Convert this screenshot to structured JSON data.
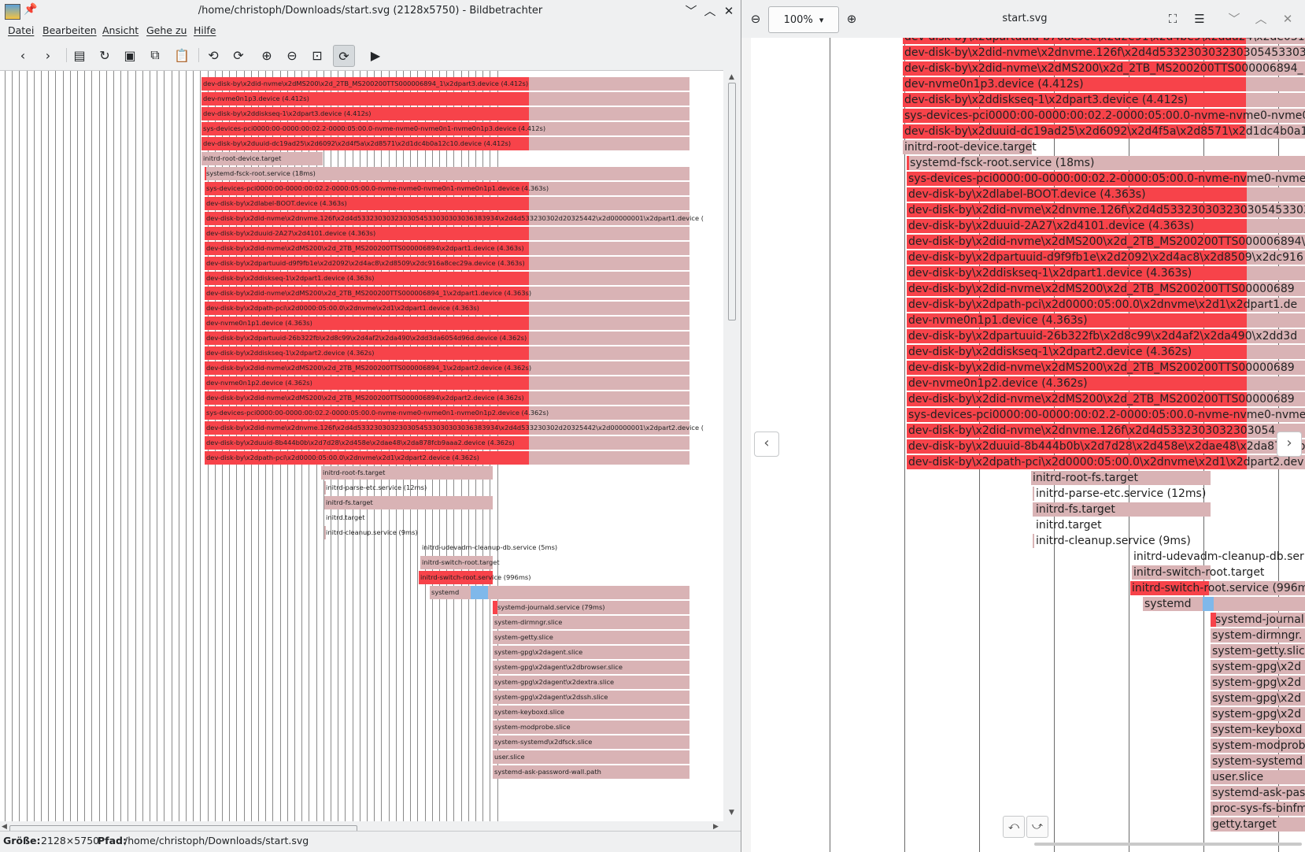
{
  "left_window": {
    "title": "/home/christoph/Downloads/start.svg (2128x5750) - Bildbetrachter",
    "menu": [
      "Datei",
      "Bearbeiten",
      "Ansicht",
      "Gehe zu",
      "Hilfe"
    ],
    "toolbar_icons": [
      "back-icon",
      "forward-icon",
      "open-icon",
      "reload-icon",
      "save-icon",
      "copy-icon",
      "paste-icon",
      "rotate-left-icon",
      "rotate-right-icon",
      "zoom-in-icon",
      "zoom-out-icon",
      "zoom-fit-icon",
      "zoom-original-icon",
      "slideshow-icon"
    ],
    "status": {
      "size_label": "Größe:",
      "size_value": "2128×5750",
      "path_label": "Pfad:",
      "path_value": "/home/christoph/Downloads/start.svg"
    }
  },
  "right_window": {
    "zoom": "100%",
    "title": "start.svg"
  },
  "left_rows": [
    {
      "label": "dev-disk-by\\x2did-nvme\\x2dMS200\\x2d_2TB_MS200200TTS000006894_1\\x2dpart3.device (4.412s)",
      "type": "active"
    },
    {
      "label": "dev-nvme0n1p3.device (4.412s)",
      "type": "active"
    },
    {
      "label": "dev-disk-by\\x2ddiskseq-1\\x2dpart3.device (4.412s)",
      "type": "active"
    },
    {
      "label": "sys-devices-pci0000:00-0000:00:02.2-0000:05:00.0-nvme-nvme0-nvme0n1-nvme0n1p3.device (4.412s)",
      "type": "active"
    },
    {
      "label": "dev-disk-by\\x2duuid-dc19ad25\\x2d6092\\x2d4f5a\\x2d8571\\x2d1dc4b0a12c10.device (4.412s)",
      "type": "active"
    },
    {
      "label": "initrd-root-device.target",
      "type": "target"
    },
    {
      "label": "systemd-fsck-root.service (18ms)",
      "type": "service"
    },
    {
      "label": "sys-devices-pci0000:00-0000:00:02.2-0000:05:00.0-nvme-nvme0-nvme0n1-nvme0n1p1.device (4.363s)",
      "type": "active"
    },
    {
      "label": "dev-disk-by\\x2dlabel-BOOT.device (4.363s)",
      "type": "active"
    },
    {
      "label": "dev-disk-by\\x2did-nvme\\x2dnvme.126f\\x2d4d5332303032303054533030303036383934\\x2d4d533230302d20325442\\x2d00000001\\x2dpart1.device (",
      "type": "active"
    },
    {
      "label": "dev-disk-by\\x2duuid-2A27\\x2d4101.device (4.363s)",
      "type": "active"
    },
    {
      "label": "dev-disk-by\\x2did-nvme\\x2dMS200\\x2d_2TB_MS200200TTS000006894\\x2dpart1.device (4.363s)",
      "type": "active"
    },
    {
      "label": "dev-disk-by\\x2dpartuuid-d9f9fb1e\\x2d2092\\x2d4ac8\\x2d8509\\x2dc916a8cec29a.device (4.363s)",
      "type": "active"
    },
    {
      "label": "dev-disk-by\\x2ddiskseq-1\\x2dpart1.device (4.363s)",
      "type": "active"
    },
    {
      "label": "dev-disk-by\\x2did-nvme\\x2dMS200\\x2d_2TB_MS200200TTS000006894_1\\x2dpart1.device (4.363s)",
      "type": "active"
    },
    {
      "label": "dev-disk-by\\x2dpath-pci\\x2d0000:05:00.0\\x2dnvme\\x2d1\\x2dpart1.device (4.363s)",
      "type": "active"
    },
    {
      "label": "dev-nvme0n1p1.device (4.363s)",
      "type": "active"
    },
    {
      "label": "dev-disk-by\\x2dpartuuid-26b322fb\\x2d8c99\\x2d4af2\\x2da490\\x2dd3da6054d96d.device (4.362s)",
      "type": "active"
    },
    {
      "label": "dev-disk-by\\x2ddiskseq-1\\x2dpart2.device (4.362s)",
      "type": "active"
    },
    {
      "label": "dev-disk-by\\x2did-nvme\\x2dMS200\\x2d_2TB_MS200200TTS000006894_1\\x2dpart2.device (4.362s)",
      "type": "active"
    },
    {
      "label": "dev-nvme0n1p2.device (4.362s)",
      "type": "active"
    },
    {
      "label": "dev-disk-by\\x2did-nvme\\x2dMS200\\x2d_2TB_MS200200TTS000006894\\x2dpart2.device (4.362s)",
      "type": "active"
    },
    {
      "label": "sys-devices-pci0000:00-0000:00:02.2-0000:05:00.0-nvme-nvme0-nvme0n1-nvme0n1p2.device (4.362s)",
      "type": "active"
    },
    {
      "label": "dev-disk-by\\x2did-nvme\\x2dnvme.126f\\x2d4d5332303032303054533030303036383934\\x2d4d533230302d20325442\\x2d00000001\\x2dpart2.device (",
      "type": "active"
    },
    {
      "label": "dev-disk-by\\x2duuid-8b444b0b\\x2d7d28\\x2d458e\\x2dae48\\x2da878fcb9aaa2.device (4.362s)",
      "type": "active"
    },
    {
      "label": "dev-disk-by\\x2dpath-pci\\x2d0000:05:00.0\\x2dnvme\\x2d1\\x2dpart2.device (4.362s)",
      "type": "active"
    },
    {
      "label": "initrd-root-fs.target",
      "type": "target"
    },
    {
      "label": "initrd-parse-etc.service (12ms)",
      "type": "service"
    },
    {
      "label": "initrd-fs.target",
      "type": "target"
    },
    {
      "label": "initrd.target",
      "type": "plain"
    },
    {
      "label": "initrd-cleanup.service (9ms)",
      "type": "service"
    },
    {
      "label": "initrd-udevadm-cleanup-db.service (5ms)",
      "type": "plain"
    },
    {
      "label": "initrd-switch-root.target",
      "type": "target"
    },
    {
      "label": "initrd-switch-root.service (996ms)",
      "type": "active"
    },
    {
      "label": "systemd",
      "type": "systemd"
    },
    {
      "label": "systemd-journald.service (79ms)",
      "type": "service"
    },
    {
      "label": "system-dirmngr.slice",
      "type": "slice"
    },
    {
      "label": "system-getty.slice",
      "type": "slice"
    },
    {
      "label": "system-gpg\\x2dagent.slice",
      "type": "slice"
    },
    {
      "label": "system-gpg\\x2dagent\\x2dbrowser.slice",
      "type": "slice"
    },
    {
      "label": "system-gpg\\x2dagent\\x2dextra.slice",
      "type": "slice"
    },
    {
      "label": "system-gpg\\x2dagent\\x2dssh.slice",
      "type": "slice"
    },
    {
      "label": "system-keyboxd.slice",
      "type": "slice"
    },
    {
      "label": "system-modprobe.slice",
      "type": "slice"
    },
    {
      "label": "system-systemd\\x2dfsck.slice",
      "type": "slice"
    },
    {
      "label": "user.slice",
      "type": "slice"
    },
    {
      "label": "systemd-ask-password-wall.path",
      "type": "slice"
    }
  ],
  "right_rows": [
    {
      "label": "dev-disk-by\\x2dpartuuid-b708c9ce\\x2d2e91\\x2d4be9\\x2daa24\\x2de031",
      "type": "active"
    },
    {
      "label": "dev-disk-by\\x2did-nvme\\x2dnvme.126f\\x2d4d5332303032303054533030303036383934",
      "type": "active"
    },
    {
      "label": "dev-disk-by\\x2did-nvme\\x2dMS200\\x2d_2TB_MS200200TTS000006894_",
      "type": "active"
    },
    {
      "label": "dev-nvme0n1p3.device (4.412s)",
      "type": "active"
    },
    {
      "label": "dev-disk-by\\x2ddiskseq-1\\x2dpart3.device (4.412s)",
      "type": "active"
    },
    {
      "label": "sys-devices-pci0000:00-0000:00:02.2-0000:05:00.0-nvme-nvme0-nvme0",
      "type": "active"
    },
    {
      "label": "dev-disk-by\\x2duuid-dc19ad25\\x2d6092\\x2d4f5a\\x2d8571\\x2d1dc4b0a1",
      "type": "active"
    },
    {
      "label": "initrd-root-device.target",
      "type": "target"
    },
    {
      "label": "systemd-fsck-root.service (18ms)",
      "type": "service"
    },
    {
      "label": "sys-devices-pci0000:00-0000:00:02.2-0000:05:00.0-nvme-nvme0-nvme",
      "type": "active"
    },
    {
      "label": "dev-disk-by\\x2dlabel-BOOT.device (4.363s)",
      "type": "active"
    },
    {
      "label": "dev-disk-by\\x2did-nvme\\x2dnvme.126f\\x2d4d5332303032303054533030",
      "type": "active"
    },
    {
      "label": "dev-disk-by\\x2duuid-2A27\\x2d4101.device (4.363s)",
      "type": "active"
    },
    {
      "label": "dev-disk-by\\x2did-nvme\\x2dMS200\\x2d_2TB_MS200200TTS000006894\\",
      "type": "active"
    },
    {
      "label": "dev-disk-by\\x2dpartuuid-d9f9fb1e\\x2d2092\\x2d4ac8\\x2d8509\\x2dc916",
      "type": "active"
    },
    {
      "label": "dev-disk-by\\x2ddiskseq-1\\x2dpart1.device (4.363s)",
      "type": "active"
    },
    {
      "label": "dev-disk-by\\x2did-nvme\\x2dMS200\\x2d_2TB_MS200200TTS00000689",
      "type": "active"
    },
    {
      "label": "dev-disk-by\\x2dpath-pci\\x2d0000:05:00.0\\x2dnvme\\x2d1\\x2dpart1.de",
      "type": "active"
    },
    {
      "label": "dev-nvme0n1p1.device (4.363s)",
      "type": "active"
    },
    {
      "label": "dev-disk-by\\x2dpartuuid-26b322fb\\x2d8c99\\x2d4af2\\x2da490\\x2dd3d",
      "type": "active"
    },
    {
      "label": "dev-disk-by\\x2ddiskseq-1\\x2dpart2.device (4.362s)",
      "type": "active"
    },
    {
      "label": "dev-disk-by\\x2did-nvme\\x2dMS200\\x2d_2TB_MS200200TTS00000689",
      "type": "active"
    },
    {
      "label": "dev-nvme0n1p2.device (4.362s)",
      "type": "active"
    },
    {
      "label": "dev-disk-by\\x2did-nvme\\x2dMS200\\x2d_2TB_MS200200TTS00000689",
      "type": "active"
    },
    {
      "label": "sys-devices-pci0000:00-0000:00:02.2-0000:05:00.0-nvme-nvme0-nvme",
      "type": "active"
    },
    {
      "label": "dev-disk-by\\x2did-nvme\\x2dnvme.126f\\x2d4d5332303032303054",
      "type": "active"
    },
    {
      "label": "dev-disk-by\\x2duuid-8b444b0b\\x2d7d28\\x2d458e\\x2dae48\\x2da878fcb",
      "type": "active"
    },
    {
      "label": "dev-disk-by\\x2dpath-pci\\x2d0000:05:00.0\\x2dnvme\\x2d1\\x2dpart2.dev",
      "type": "active"
    },
    {
      "label": "initrd-root-fs.target",
      "type": "target"
    },
    {
      "label": "initrd-parse-etc.service (12ms)",
      "type": "service"
    },
    {
      "label": "initrd-fs.target",
      "type": "target"
    },
    {
      "label": "initrd.target",
      "type": "plain"
    },
    {
      "label": "initrd-cleanup.service (9ms)",
      "type": "service"
    },
    {
      "label": "initrd-udevadm-cleanup-db.ser",
      "type": "plain"
    },
    {
      "label": "initrd-switch-root.target",
      "type": "target"
    },
    {
      "label": "initrd-switch-root.service (996m",
      "type": "active"
    },
    {
      "label": "systemd",
      "type": "systemd"
    },
    {
      "label": "systemd-journal",
      "type": "service"
    },
    {
      "label": "system-dirmngr.",
      "type": "slice"
    },
    {
      "label": "system-getty.slic",
      "type": "slice"
    },
    {
      "label": "system-gpg\\x2d",
      "type": "slice"
    },
    {
      "label": "system-gpg\\x2d",
      "type": "slice"
    },
    {
      "label": "system-gpg\\x2d",
      "type": "slice"
    },
    {
      "label": "system-gpg\\x2d",
      "type": "slice"
    },
    {
      "label": "system-keyboxd",
      "type": "slice"
    },
    {
      "label": "system-modprob",
      "type": "slice"
    },
    {
      "label": "system-systemd",
      "type": "slice"
    },
    {
      "label": "user.slice",
      "type": "slice"
    },
    {
      "label": "systemd-ask-pas",
      "type": "slice"
    },
    {
      "label": "proc-sys-fs-binfm",
      "type": "slice"
    },
    {
      "label": "getty.target",
      "type": "slice"
    }
  ],
  "colors": {
    "active": "#f7434a",
    "inactive": "#d9b3b5",
    "accent": "#7fb8ea"
  }
}
